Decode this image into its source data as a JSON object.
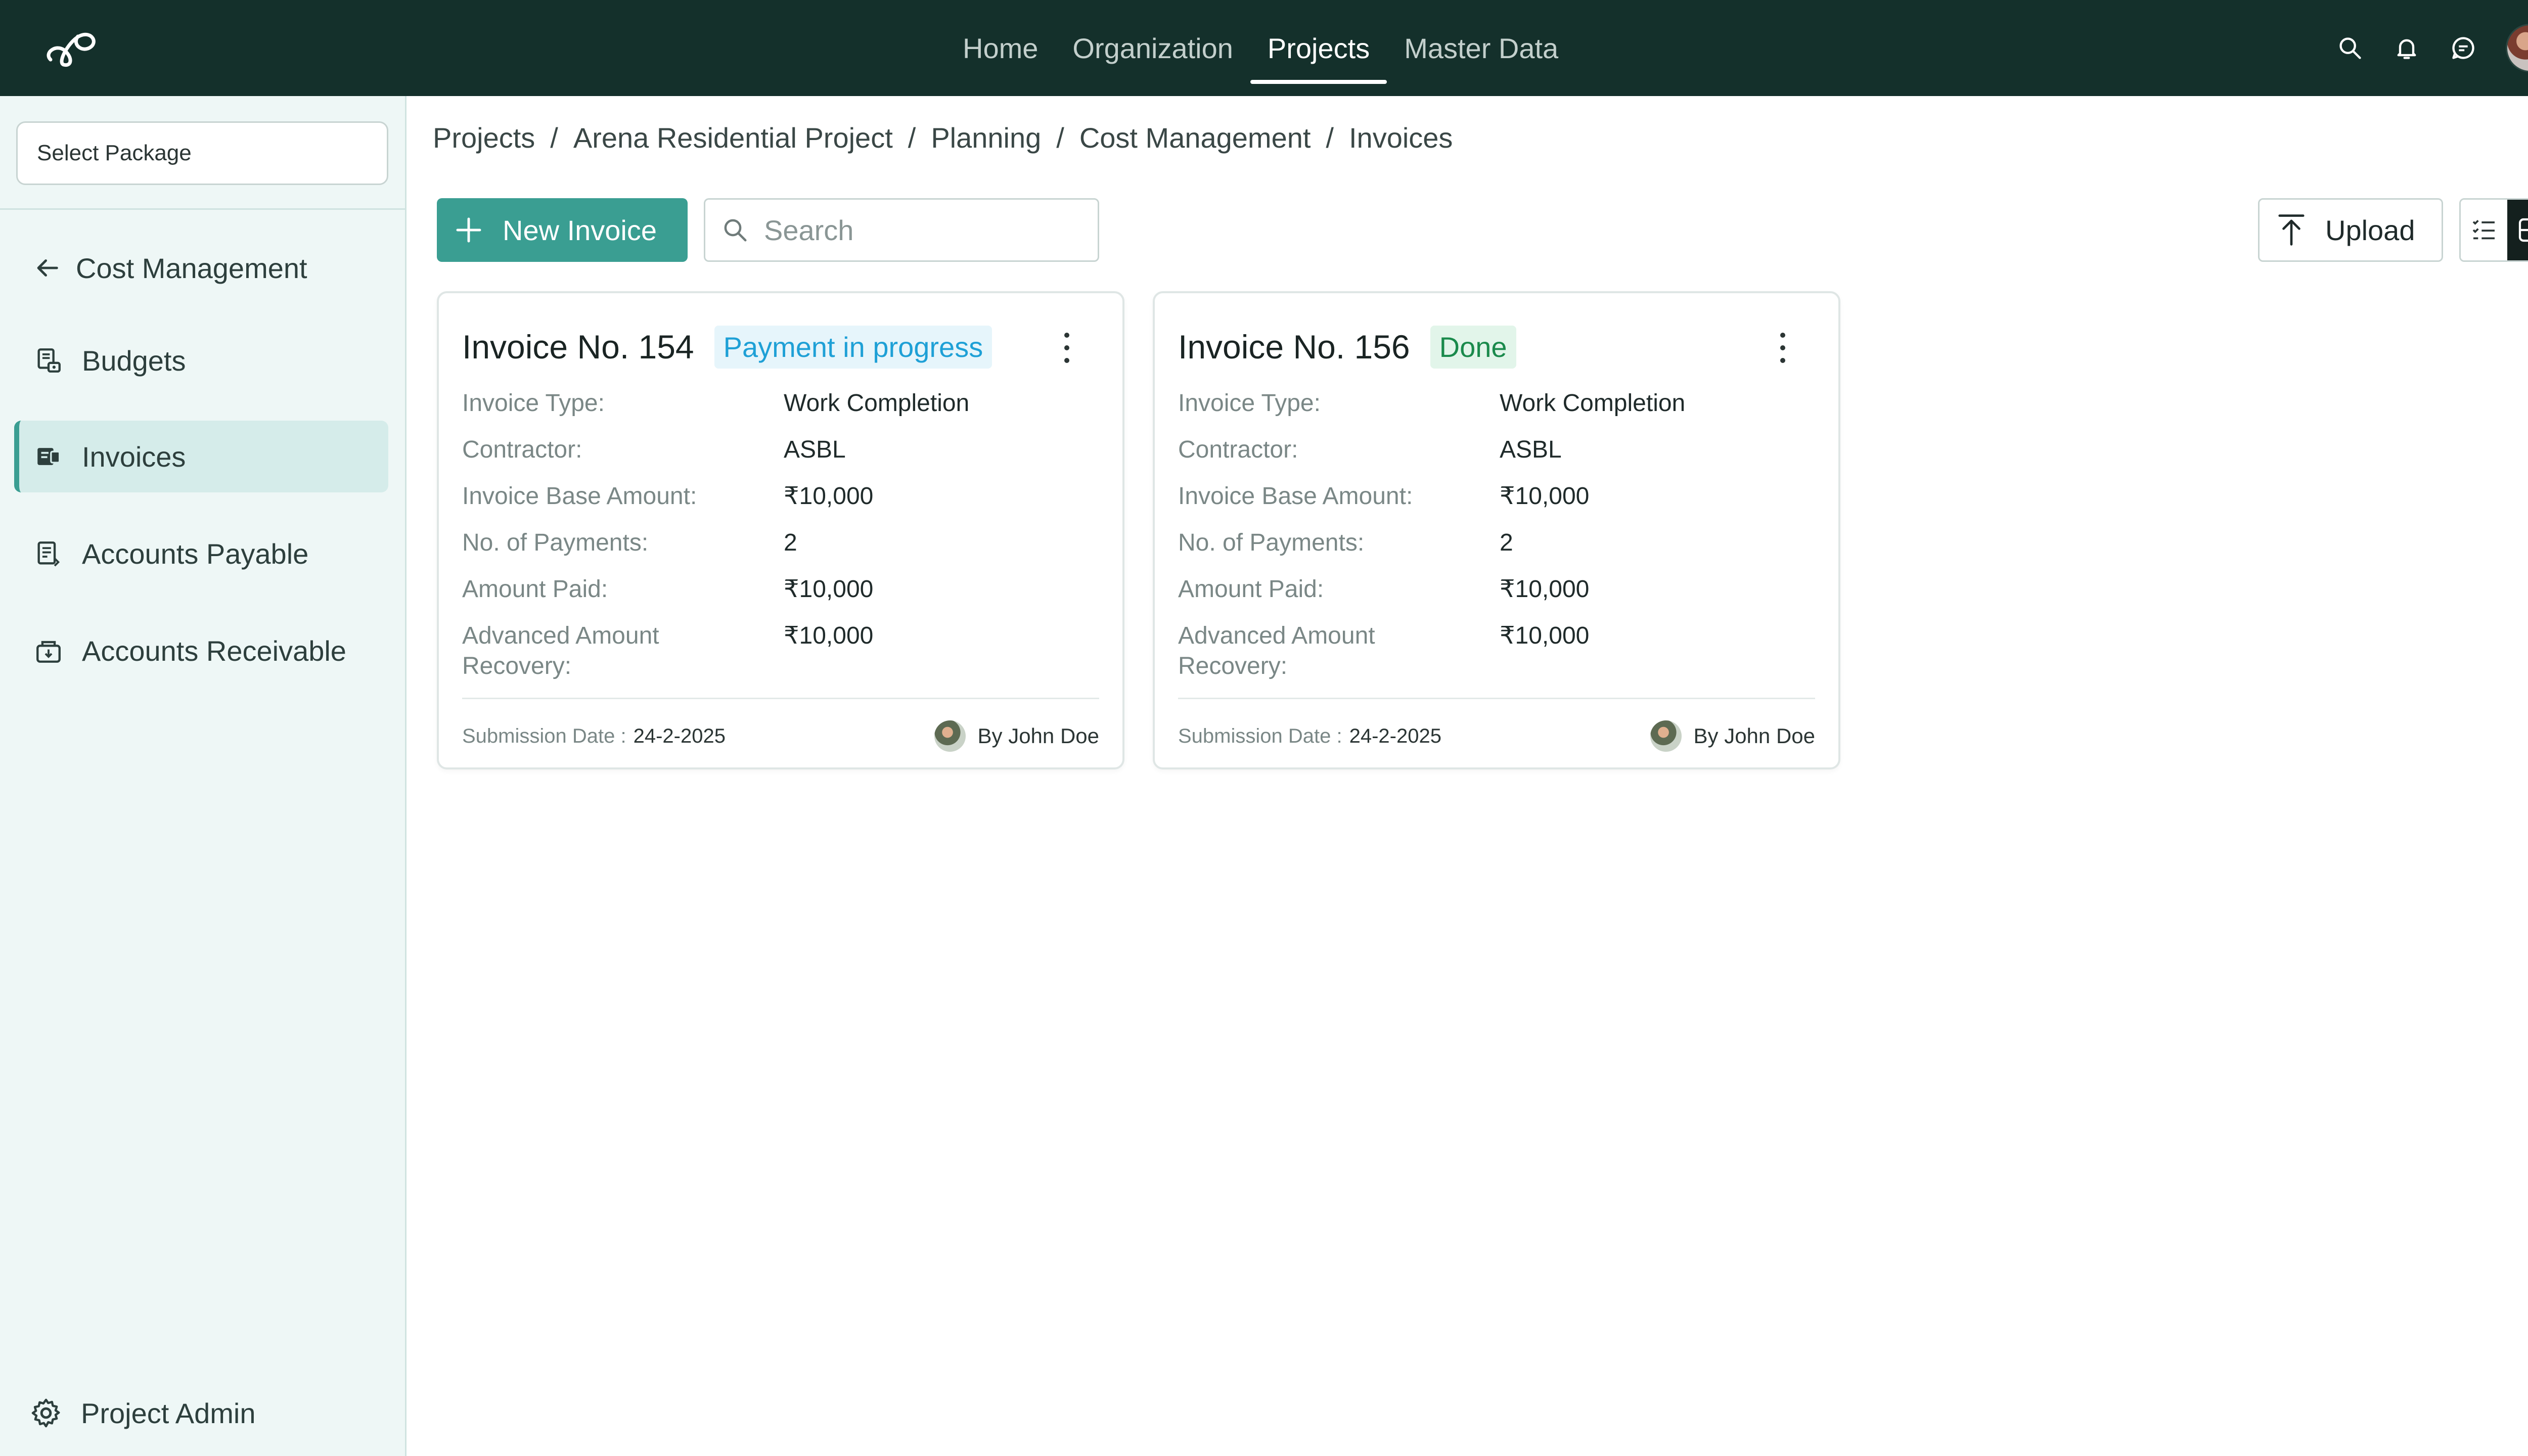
{
  "topnav": {
    "items": [
      "Home",
      "Organization",
      "Projects",
      "Master Data"
    ],
    "active": "Projects"
  },
  "top_icons": [
    "search-icon",
    "bell-icon",
    "chat-icon",
    "user-avatar"
  ],
  "sidebar": {
    "package_placeholder": "Select Package",
    "back_label": "Cost Management",
    "items": [
      {
        "label": "Budgets",
        "icon": "budget-icon"
      },
      {
        "label": "Invoices",
        "icon": "invoice-icon",
        "active": true
      },
      {
        "label": "Accounts Payable",
        "icon": "payable-icon"
      },
      {
        "label": "Accounts Receivable",
        "icon": "receivable-icon"
      }
    ],
    "admin_label": "Project Admin"
  },
  "breadcrumb": [
    "Projects",
    "Arena Residential Project",
    "Planning",
    "Cost Management",
    "Invoices"
  ],
  "toolbar": {
    "new_invoice_label": "New Invoice",
    "search_placeholder": "Search",
    "upload_label": "Upload"
  },
  "cards": [
    {
      "title": "Invoice No. 154",
      "status": "Payment in progress",
      "fields": [
        {
          "label": "Invoice Type:",
          "value": "Work Completion"
        },
        {
          "label": "Contractor:",
          "value": "ASBL"
        },
        {
          "label": "Invoice Base Amount:",
          "value": "₹10,000"
        },
        {
          "label": "No. of Payments:",
          "value": "2"
        },
        {
          "label": "Amount Paid:",
          "value": "₹10,000"
        },
        {
          "label": "Advanced Amount Recovery:",
          "value": "₹10,000"
        }
      ],
      "submission_label": "Submission Date :",
      "submission_date": "24-2-2025",
      "by": "By John Doe"
    },
    {
      "title": "Invoice No. 156",
      "status": "Done",
      "fields": [
        {
          "label": "Invoice Type:",
          "value": "Work Completion"
        },
        {
          "label": "Contractor:",
          "value": "ASBL"
        },
        {
          "label": "Invoice Base Amount:",
          "value": "₹10,000"
        },
        {
          "label": "No. of Payments:",
          "value": "2"
        },
        {
          "label": "Amount Paid:",
          "value": "₹10,000"
        },
        {
          "label": "Advanced Amount Recovery:",
          "value": "₹10,000"
        }
      ],
      "submission_label": "Submission Date :",
      "submission_date": "24-2-2025",
      "by": "By John Doe"
    }
  ],
  "colors": {
    "topbar": "#14302b",
    "accent": "#3a9e92",
    "sidebar_bg": "#eef7f6",
    "status_progress": "#1ea0d6",
    "status_done": "#1a8a4c"
  }
}
